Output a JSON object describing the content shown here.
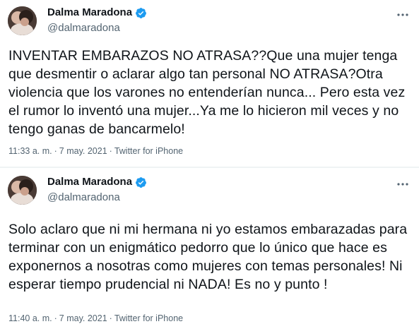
{
  "colors": {
    "verified_blue": "#1d9bf0",
    "secondary_text": "#536471",
    "primary_text": "#0f1419",
    "divider": "#eff3f4"
  },
  "tweets": [
    {
      "author": {
        "name": "Dalma Maradona",
        "handle": "@dalmaradona",
        "verified_icon": "verified-badge-icon",
        "avatar_icon": "profile-avatar"
      },
      "text": "INVENTAR EMBARAZOS NO ATRASA??Que una mujer tenga que desmentir o aclarar algo tan personal NO ATRASA?Otra violencia que los varones no entenderían nunca... Pero esta vez el rumor lo inventó una mujer...Ya me lo hicieron mil veces y no tengo ganas de bancarmelo!",
      "time": "11:33 a. m.",
      "date": "7 may. 2021",
      "source": "Twitter for iPhone",
      "separator": "·",
      "more_icon": "more-options-icon"
    },
    {
      "author": {
        "name": "Dalma Maradona",
        "handle": "@dalmaradona",
        "verified_icon": "verified-badge-icon",
        "avatar_icon": "profile-avatar"
      },
      "text": "Solo aclaro que ni mi hermana ni yo estamos embarazadas para terminar con un enigmático pedorro que lo único que hace es exponernos a nosotras como mujeres con temas personales! Ni esperar tiempo prudencial ni NADA! Es no y punto !",
      "time": "11:40 a. m.",
      "date": "7 may. 2021",
      "source": "Twitter for iPhone",
      "separator": "·",
      "more_icon": "more-options-icon"
    }
  ]
}
